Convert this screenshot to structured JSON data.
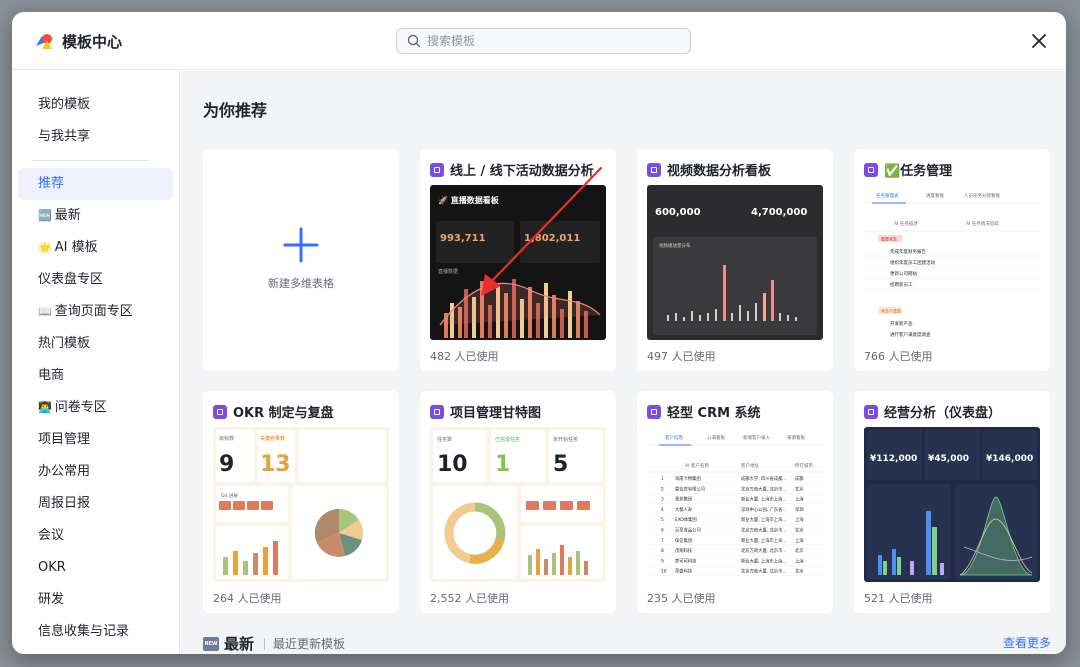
{
  "app": {
    "title": "模板中心"
  },
  "search": {
    "placeholder": "搜索模板"
  },
  "sidebar": {
    "top": [
      "我的模板",
      "与我共享"
    ],
    "items": [
      {
        "label": "推荐",
        "active": true
      },
      {
        "label": "最新",
        "emoji": "🆕"
      },
      {
        "label": "AI 模板",
        "emoji": "🌟"
      },
      {
        "label": "仪表盘专区"
      },
      {
        "label": "查询页面专区",
        "emoji": "📖"
      },
      {
        "label": "热门模板"
      },
      {
        "label": "电商"
      },
      {
        "label": "问卷专区",
        "emoji": "👨‍💻"
      },
      {
        "label": "项目管理"
      },
      {
        "label": "办公常用"
      },
      {
        "label": "周报日报"
      },
      {
        "label": "会议"
      },
      {
        "label": "OKR"
      },
      {
        "label": "研发"
      },
      {
        "label": "信息收集与记录"
      }
    ]
  },
  "main": {
    "section_title": "为你推荐",
    "new_card_label": "新建多维表格",
    "cards": [
      {
        "title": "线上 / 线下活动数据分析",
        "usage": "482 人已使用",
        "thumb": {
          "heading": "🚀 直播数据看板",
          "kpi1": "993,711",
          "kpi2": "1,802,011",
          "sub": "直播数据"
        }
      },
      {
        "title": "视频数据分析看板",
        "usage": "497 人已使用",
        "thumb": {
          "kpi1": "600,000",
          "kpi2": "4,700,000",
          "sub": "视频播放量分布"
        }
      },
      {
        "title": "✅任务管理",
        "usage": "766 人已使用",
        "thumb": {
          "tab1": "任务管理表",
          "tab2": "进度看板",
          "tab3": "人员任务分配看板",
          "col1": "AI 任务描述",
          "col2": "AI 任务情况追踪",
          "group1": "重要紧急",
          "group2": "紧急不重要",
          "rows": [
            "完成年度财务报告",
            "组织年度员工团建活动",
            "更新公司网站",
            "招聘新员工",
            "开发新产品",
            "进行客户满意度调查"
          ]
        }
      },
      {
        "title": "OKR 制定与复盘",
        "usage": "264 人已使用",
        "thumb": {
          "l1": "目标数",
          "v1": "9",
          "l2": "关键结果数",
          "v2": "13",
          "sub": "Q4 进展"
        }
      },
      {
        "title": "项目管理甘特图",
        "usage": "2,552 人已使用",
        "thumb": {
          "l1": "任务数",
          "v1": "10",
          "l2": "已完成任务",
          "v2": "1",
          "l3": "未开始任务",
          "v3": "5"
        }
      },
      {
        "title": "轻型 CRM 系统",
        "usage": "235 人已使用",
        "thumb": {
          "tab1": "客户信息",
          "tab2": "公海看板",
          "tab3": "新增客户录入",
          "tab4": "来源看板",
          "col1": "AI 客户名称",
          "col2": "客户地址",
          "col3": "所在城市",
          "rows": [
            [
              "1",
              "海南卡特集团",
              "成都大学, 四川省成都...",
              "成都"
            ],
            [
              "2",
              "晨佳房有限公司",
              "北京万商大厦, 北京市...",
              "北京"
            ],
            [
              "3",
              "意邦集团",
              "新业大厦, 上海市上海...",
              "上海"
            ],
            [
              "4",
              "大都人寿",
              "深圳中心公园, 广东省...",
              "深圳"
            ],
            [
              "5",
              "EXO体集团",
              "新业大厦, 上海市上海...",
              "上海"
            ],
            [
              "6",
              "百草食品公司",
              "北京万商大厦, 北京市...",
              "北京"
            ],
            [
              "7",
              "保信集团",
              "新业大厦, 上海市上海...",
              "上海"
            ],
            [
              "8",
              "茂翔科技",
              "北京万商大厦, 北京市...",
              "北京"
            ],
            [
              "9",
              "梦可可科技",
              "新业大厦, 上海市上海...",
              "上海"
            ],
            [
              "10",
              "荣盛科技",
              "北京万商大厦, 北京市...",
              "北京"
            ]
          ]
        }
      },
      {
        "title": "经营分析（仪表盘）",
        "usage": "521 人已使用",
        "thumb": {
          "v1": "¥112,000",
          "v2": "¥45,000",
          "v3": "¥146,000"
        }
      }
    ],
    "bottom": {
      "title": "最新",
      "badge": "NEW",
      "sub": "最近更新模板",
      "more": "查看更多"
    }
  },
  "colors": {
    "accent": "#3370ff",
    "arrow": "#e8302c",
    "template_icon": "#7b4be5"
  }
}
